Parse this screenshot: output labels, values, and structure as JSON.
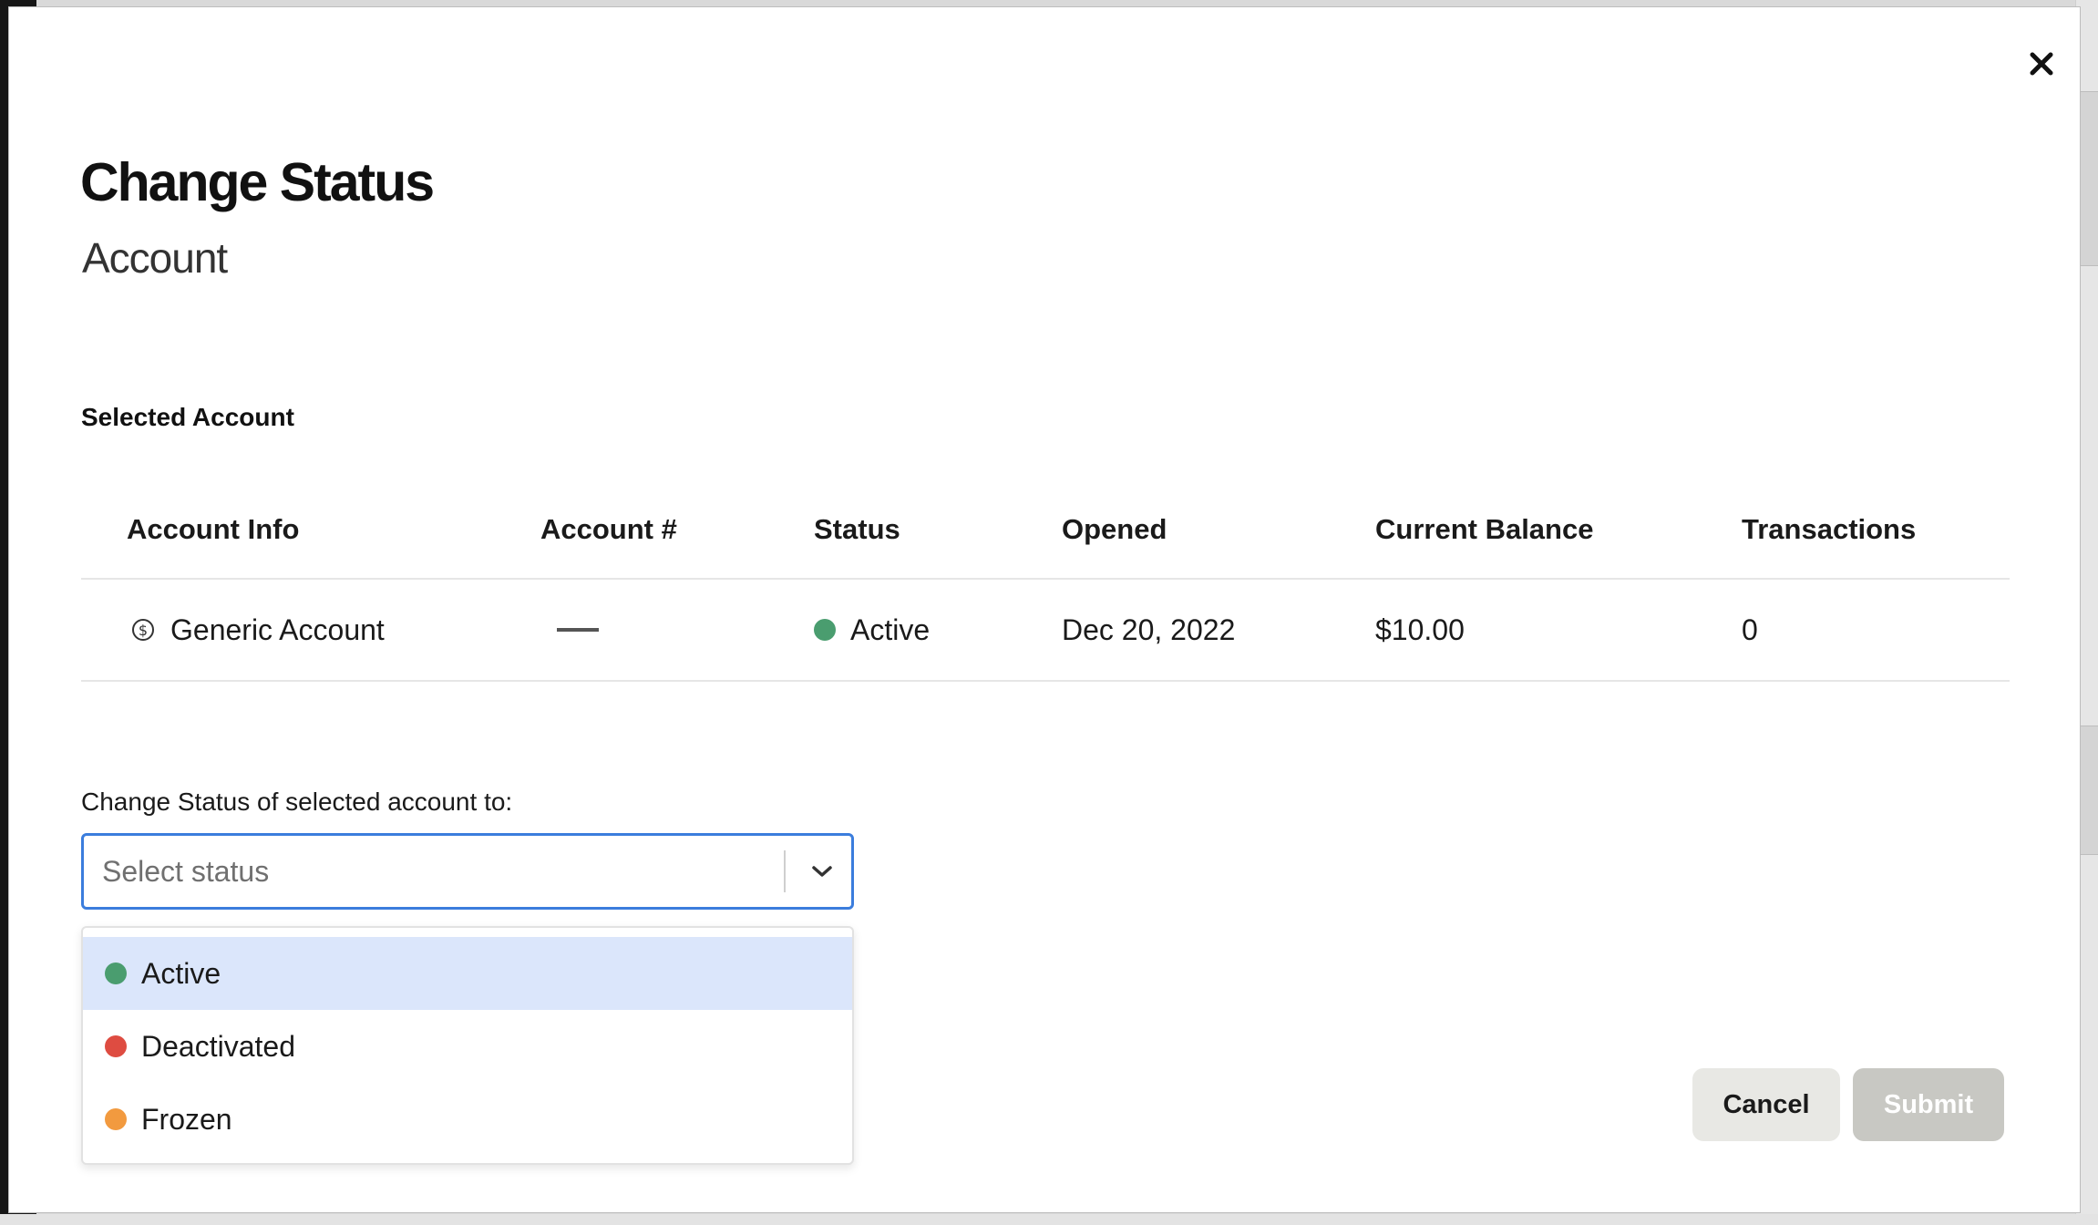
{
  "modal": {
    "title": "Change Status",
    "subtitle": "Account",
    "section_label": "Selected Account"
  },
  "table": {
    "columns": [
      "Account Info",
      "Account #",
      "Status",
      "Opened",
      "Current Balance",
      "Transactions"
    ],
    "row": {
      "account_info": "Generic Account",
      "account_number": "—",
      "status": "Active",
      "status_color": "#4a9d6f",
      "opened": "Dec 20, 2022",
      "balance": "$10.00",
      "transactions": "0"
    }
  },
  "change_status": {
    "label": "Change Status of selected account to:",
    "placeholder": "Select status",
    "options": [
      {
        "label": "Active",
        "color": "#4a9d6f",
        "highlighted": true
      },
      {
        "label": "Deactivated",
        "color": "#de4c41",
        "highlighted": false
      },
      {
        "label": "Frozen",
        "color": "#f29a3f",
        "highlighted": false
      }
    ]
  },
  "buttons": {
    "cancel": "Cancel",
    "submit": "Submit"
  },
  "icons": {
    "close": "close-icon",
    "dollar": "dollar-circle-icon",
    "chevron": "chevron-down-icon"
  }
}
